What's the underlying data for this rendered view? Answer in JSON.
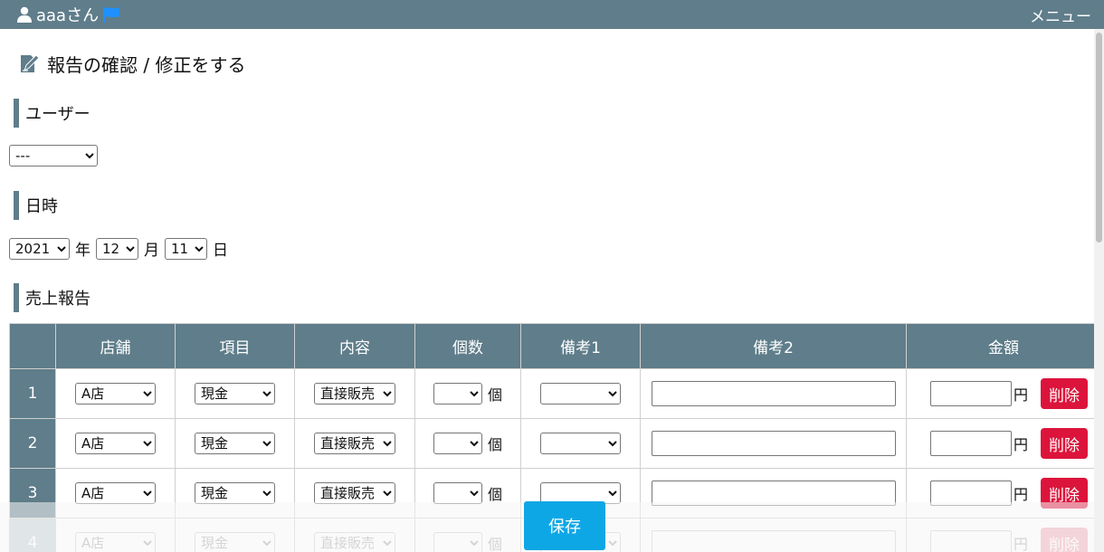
{
  "header": {
    "username": "aaaさん",
    "menu_label": "メニュー"
  },
  "page": {
    "title": "報告の確認 / 修正をする"
  },
  "user_section": {
    "heading": "ユーザー",
    "selected": "---"
  },
  "date_section": {
    "heading": "日時",
    "year": "2021",
    "year_suffix": "年",
    "month": "12",
    "month_suffix": "月",
    "day": "11",
    "day_suffix": "日"
  },
  "sales_section": {
    "heading": "売上報告",
    "columns": [
      "店舗",
      "項目",
      "内容",
      "個数",
      "備考1",
      "備考2",
      "金額"
    ],
    "rows": [
      {
        "no": "1",
        "store": "A店",
        "item": "現金",
        "content": "直接販売",
        "count": "",
        "count_unit": "個",
        "memo1": "",
        "memo2": "",
        "amount": "",
        "amount_unit": "円",
        "delete_label": "削除"
      },
      {
        "no": "2",
        "store": "A店",
        "item": "現金",
        "content": "直接販売",
        "count": "",
        "count_unit": "個",
        "memo1": "",
        "memo2": "",
        "amount": "",
        "amount_unit": "円",
        "delete_label": "削除"
      },
      {
        "no": "3",
        "store": "A店",
        "item": "現金",
        "content": "直接販売",
        "count": "",
        "count_unit": "個",
        "memo1": "",
        "memo2": "",
        "amount": "",
        "amount_unit": "円",
        "delete_label": "削除"
      },
      {
        "no": "4",
        "store": "A店",
        "item": "現金",
        "content": "直接販売",
        "count": "",
        "count_unit": "個",
        "memo1": "",
        "memo2": "",
        "amount": "",
        "amount_unit": "円",
        "delete_label": "削除"
      }
    ]
  },
  "save_label": "保存",
  "colors": {
    "header_bg": "#5f7d8a",
    "delete": "#dc143c",
    "save": "#0ea7e6",
    "flag": "#1e90ff"
  },
  "icons": {
    "user": "user-icon",
    "flag": "flag-icon",
    "edit": "edit-document-icon"
  }
}
